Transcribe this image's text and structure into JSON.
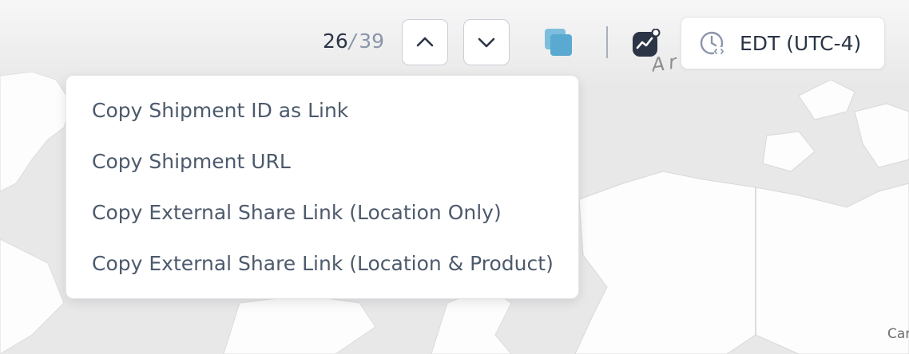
{
  "map": {
    "arctic_label": "Arctic Oc",
    "canada_label": "Car"
  },
  "toolbar": {
    "current_index": "26",
    "separator": "/",
    "total_count": "39",
    "timezone_label": "EDT (UTC-4)"
  },
  "icons": {
    "previous": "chevron-up-icon",
    "next": "chevron-down-icon",
    "copy": "copy-icon",
    "analytics": "analytics-icon",
    "timezone": "clock-icon"
  },
  "colors": {
    "accent_copy": "#5aa9d0",
    "icon_dark": "#2b3546",
    "menu_text": "#4d5a6c"
  },
  "copy_menu": {
    "items": [
      "Copy Shipment ID as Link",
      "Copy Shipment URL",
      "Copy External Share Link (Location Only)",
      "Copy External Share Link (Location & Product)"
    ]
  }
}
